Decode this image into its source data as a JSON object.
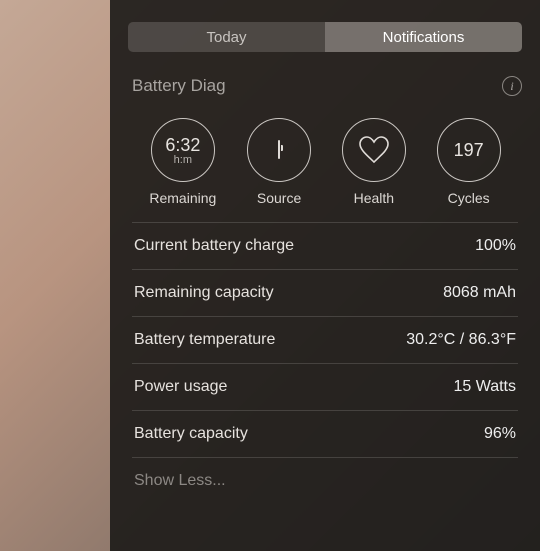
{
  "tabs": {
    "today": "Today",
    "notifications": "Notifications"
  },
  "widget": {
    "title": "Battery Diag",
    "circles": {
      "remaining": {
        "primary": "6:32",
        "secondary": "h:m",
        "label": "Remaining"
      },
      "source": {
        "label": "Source"
      },
      "health": {
        "label": "Health"
      },
      "cycles": {
        "primary": "197",
        "label": "Cycles"
      }
    },
    "rows": {
      "charge": {
        "label": "Current battery charge",
        "value": "100%"
      },
      "remaining_capacity": {
        "label": "Remaining capacity",
        "value": "8068 mAh"
      },
      "temperature": {
        "label": "Battery temperature",
        "value": "30.2°C / 86.3°F"
      },
      "power_usage": {
        "label": "Power usage",
        "value": "15 Watts"
      },
      "capacity": {
        "label": "Battery capacity",
        "value": "96%"
      }
    },
    "show_less": "Show Less..."
  }
}
